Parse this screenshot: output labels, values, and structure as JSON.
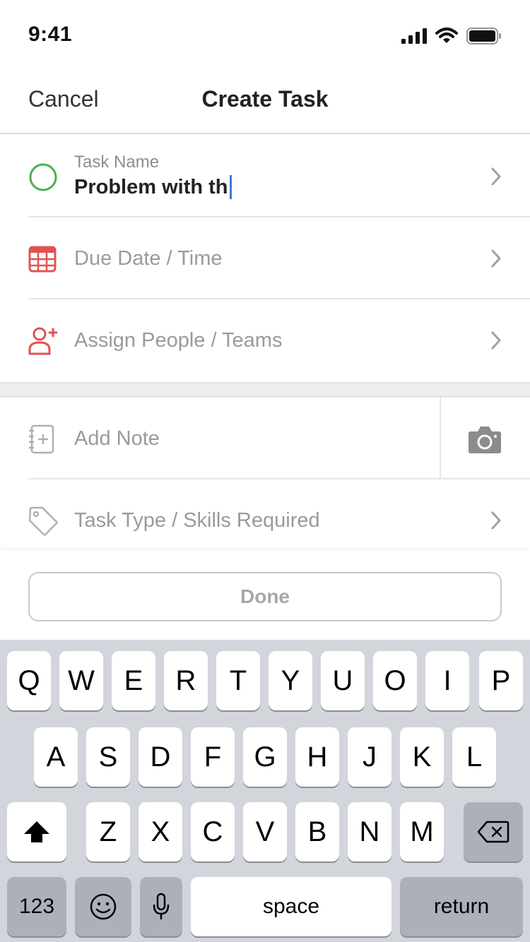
{
  "status_bar": {
    "time": "9:41"
  },
  "nav": {
    "cancel": "Cancel",
    "title": "Create Task"
  },
  "form": {
    "task_name": {
      "caption": "Task Name",
      "value": "Problem with th"
    },
    "due_date": {
      "label": "Due Date / Time"
    },
    "assign": {
      "label": "Assign People / Teams"
    },
    "note": {
      "label": "Add Note"
    },
    "task_type": {
      "label": "Task Type / Skills Required"
    }
  },
  "done": {
    "label": "Done"
  },
  "keyboard": {
    "row1": [
      "Q",
      "W",
      "E",
      "R",
      "T",
      "Y",
      "U",
      "O",
      "I",
      "P"
    ],
    "row2": [
      "A",
      "S",
      "D",
      "F",
      "G",
      "H",
      "J",
      "K",
      "L"
    ],
    "row3": [
      "Z",
      "X",
      "C",
      "V",
      "B",
      "N",
      "M"
    ],
    "numbers": "123",
    "space": "space",
    "return": "return"
  },
  "colors": {
    "accent_green": "#4caf50",
    "accent_red": "#e05252",
    "cursor_blue": "#3b78d8"
  }
}
